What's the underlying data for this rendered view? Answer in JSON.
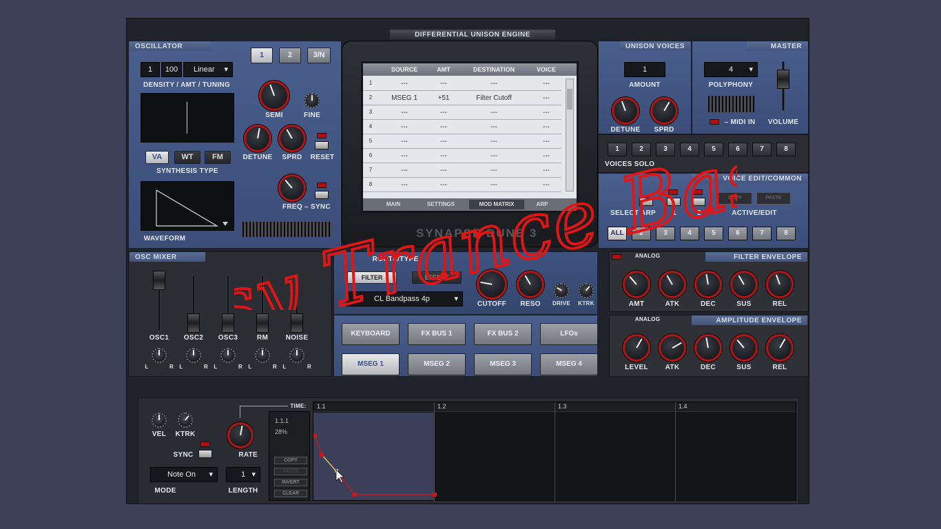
{
  "oscillator": {
    "title": "OSCILLATOR",
    "tabs": [
      "1",
      "2",
      "3/N"
    ],
    "density": "1",
    "amount": "100",
    "tuning": "Linear",
    "density_label": "DENSITY / AMT / TUNING",
    "synth_types": [
      "VA",
      "WT",
      "FM"
    ],
    "synth_type_label": "SYNTHESIS TYPE",
    "waveform_label": "WAVEFORM",
    "semi": "SEMI",
    "fine": "FINE",
    "detune": "DETUNE",
    "sprd": "SPRD",
    "reset": "RESET",
    "freq_sync": "FREQ – SYNC"
  },
  "engine": {
    "title": "DIFFERENTIAL UNISON ENGINE",
    "brand": "SYNAPSE DUNE 3"
  },
  "matrix": {
    "headers": [
      "SOURCE",
      "AMT",
      "DESTINATION",
      "VOICE"
    ],
    "rows": [
      {
        "n": "1",
        "source": "---",
        "amt": "---",
        "dest": "---",
        "voice": "---"
      },
      {
        "n": "2",
        "source": "MSEG 1",
        "amt": "+51",
        "dest": "Filter Cutoff",
        "voice": "---"
      },
      {
        "n": "3",
        "source": "---",
        "amt": "---",
        "dest": "---",
        "voice": "---"
      },
      {
        "n": "4",
        "source": "---",
        "amt": "---",
        "dest": "---",
        "voice": "---"
      },
      {
        "n": "5",
        "source": "---",
        "amt": "---",
        "dest": "---",
        "voice": "---"
      },
      {
        "n": "6",
        "source": "---",
        "amt": "---",
        "dest": "---",
        "voice": "---"
      },
      {
        "n": "7",
        "source": "---",
        "amt": "---",
        "dest": "---",
        "voice": "---"
      },
      {
        "n": "8",
        "source": "---",
        "amt": "---",
        "dest": "---",
        "voice": "---"
      }
    ],
    "tabs": [
      "MAIN",
      "SETTINGS",
      "MOD MATRIX",
      "ARP"
    ]
  },
  "unison": {
    "title": "UNISON VOICES",
    "amount": "1",
    "amount_label": "AMOUNT",
    "detune": "DETUNE",
    "sprd": "SPRD",
    "voices_solo_label": "VOICES SOLO",
    "voices": [
      "1",
      "2",
      "3",
      "4",
      "5",
      "6",
      "7",
      "8"
    ]
  },
  "master": {
    "title": "MASTER",
    "polyphony": "4",
    "polyphony_label": "POLYPHONY",
    "midi_in": "– MIDI IN",
    "volume": "VOLUME"
  },
  "voice_edit": {
    "title": "VOICE EDIT/COMMON",
    "copy": "COPY",
    "paste": "PASTE",
    "active_edit": "ACTIVE/EDIT",
    "buttons": [
      "ALL",
      "2",
      "3",
      "4",
      "5",
      "6",
      "7",
      "8"
    ],
    "labels": [
      "SELECT",
      "ARP",
      "1",
      "2"
    ]
  },
  "osc_mixer": {
    "title": "OSC MIXER",
    "channels": [
      "OSC1",
      "OSC2",
      "OSC3",
      "RM",
      "NOISE"
    ],
    "lr": "L",
    "rr": "R"
  },
  "filter": {
    "route_type": "ROUTE/TYPE",
    "filter_btn": "FILTER",
    "effect_btn": "EFFECT",
    "type": "CL Bandpass 4p",
    "knobs": [
      "CUTOFF",
      "RESO",
      "DRIVE",
      "KTRK"
    ]
  },
  "filter_env": {
    "title": "FILTER ENVELOPE",
    "mode": "ANALOG",
    "knobs": [
      "AMT",
      "ATK",
      "DEC",
      "SUS",
      "REL"
    ]
  },
  "amp_env": {
    "title": "AMPLITUDE ENVELOPE",
    "mode": "ANALOG",
    "knobs": [
      "LEVEL",
      "ATK",
      "DEC",
      "SUS",
      "REL"
    ]
  },
  "modbuttons": {
    "row1": [
      "KEYBOARD",
      "FX BUS 1",
      "FX BUS 2",
      "LFOs"
    ],
    "row2": [
      "MSEG 1",
      "MSEG 2",
      "MSEG 3",
      "MSEG 4"
    ]
  },
  "mseg": {
    "vel": "VEL",
    "ktrk": "KTRK",
    "sync": "SYNC",
    "rate": "RATE",
    "mode_value": "Note On",
    "mode_label": "MODE",
    "length_value": "1",
    "length_label": "LENGTH",
    "time_label": "TIME:",
    "position": "1.1.1",
    "percent": "28%",
    "actions": [
      "COPY",
      "PASTE",
      "INVERT",
      "CLEAR"
    ],
    "markers": [
      "1.1",
      "1.2",
      "1.3",
      "1.4"
    ]
  },
  "overlay_text": "Psy Trance Bass",
  "colors": {
    "accent": "#c81414",
    "panel": "#43557e",
    "bg": "#3c4157"
  }
}
